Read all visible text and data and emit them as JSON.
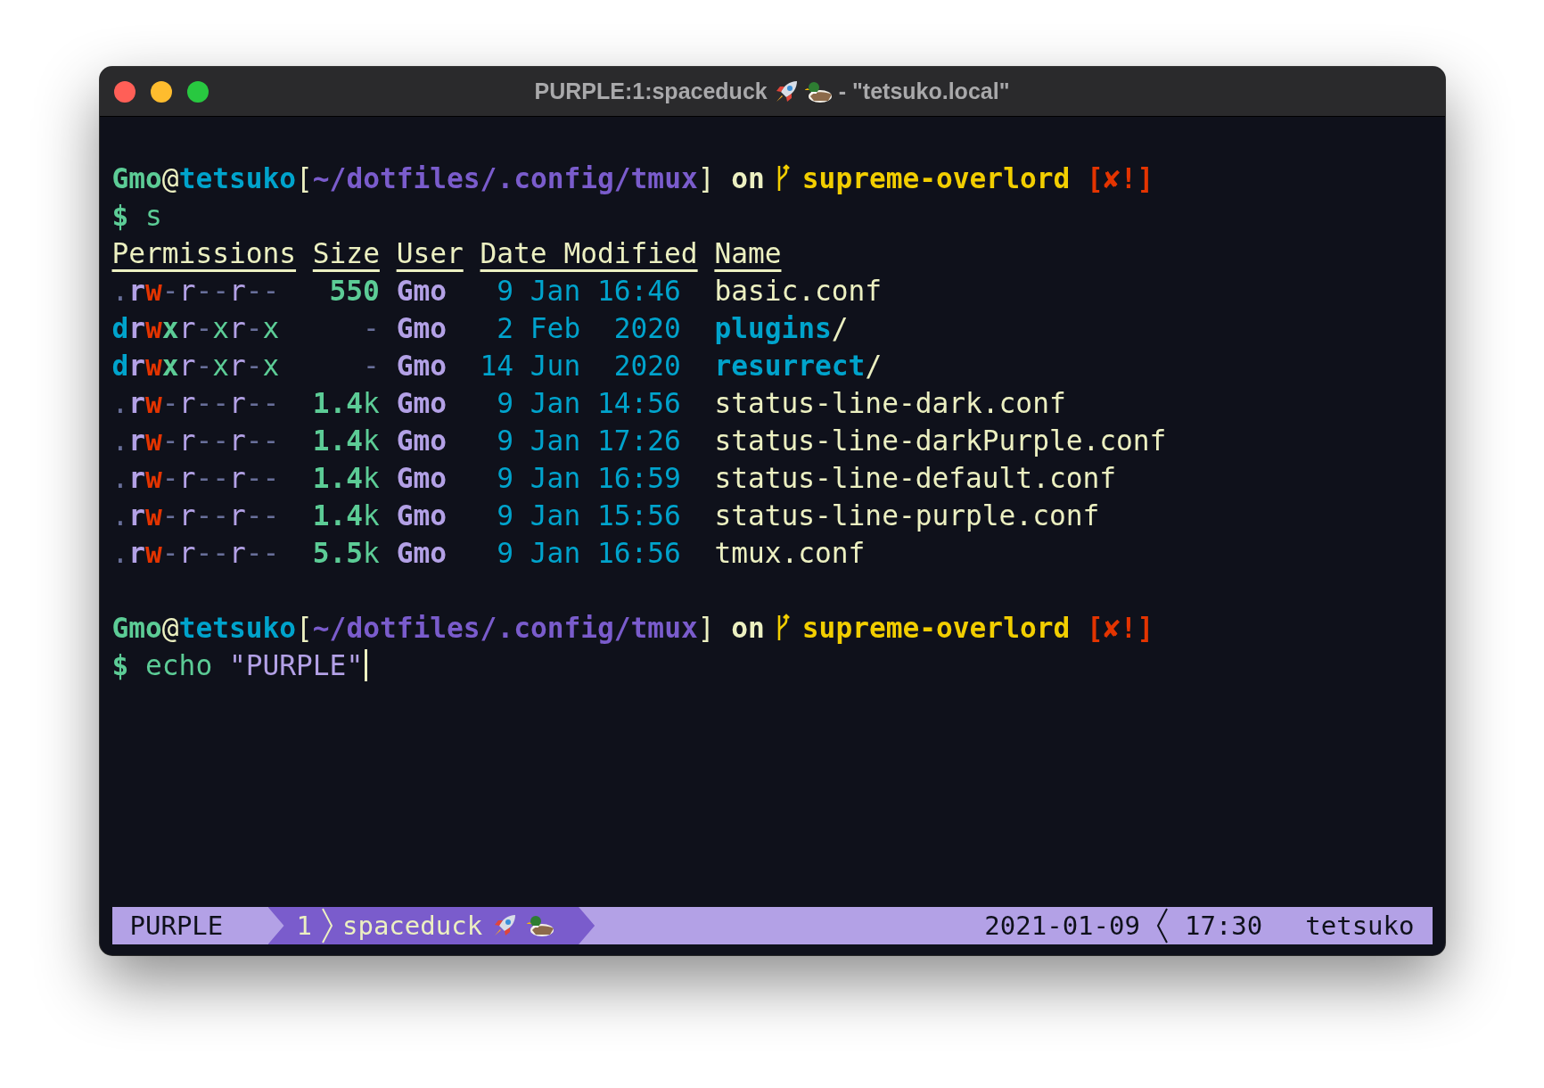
{
  "window": {
    "title": "PURPLE:1:spaceduck",
    "title_suffix": "- \"tetsuko.local\""
  },
  "terminal": {
    "blocks": [
      {
        "kind": "prompt",
        "user": "Gmo",
        "at": "@",
        "host": "tetsuko",
        "open": "[",
        "path": "~/dotfiles/.config/tmux",
        "close": "]",
        "on": "on",
        "branch": "supreme-overlord",
        "status": "[✘!]"
      },
      {
        "kind": "command",
        "symbol": "$",
        "command": "s"
      },
      {
        "kind": "listing",
        "columns": [
          "Permissions",
          "Size",
          "User",
          "Date Modified",
          "Name"
        ],
        "rows": [
          {
            "permissions": [
              {
                "text": ".",
                "kind": "type"
              },
              {
                "text": "r",
                "kind": "owner-read"
              },
              {
                "text": "w",
                "kind": "owner-write"
              },
              {
                "text": "-",
                "kind": "none"
              },
              {
                "text": "r",
                "kind": "read"
              },
              {
                "text": "--",
                "kind": "none"
              },
              {
                "text": "r",
                "kind": "read"
              },
              {
                "text": "--",
                "kind": "none"
              }
            ],
            "size": {
              "value": "550",
              "kind": "number"
            },
            "user": "Gmo",
            "date": "9 Jan 16:46",
            "name": "basic.conf",
            "kind": "file"
          },
          {
            "permissions": [
              {
                "text": "d",
                "kind": "dir"
              },
              {
                "text": "r",
                "kind": "owner-read"
              },
              {
                "text": "w",
                "kind": "owner-write"
              },
              {
                "text": "x",
                "kind": "owner-exec"
              },
              {
                "text": "r",
                "kind": "read"
              },
              {
                "text": "-",
                "kind": "none"
              },
              {
                "text": "x",
                "kind": "exec"
              },
              {
                "text": "r",
                "kind": "read"
              },
              {
                "text": "-",
                "kind": "none"
              },
              {
                "text": "x",
                "kind": "exec"
              }
            ],
            "size": {
              "value": "-",
              "kind": "empty"
            },
            "user": "Gmo",
            "date": "2 Feb  2020",
            "name": "plugins",
            "suffix": "/",
            "kind": "dir"
          },
          {
            "permissions": [
              {
                "text": "d",
                "kind": "dir"
              },
              {
                "text": "r",
                "kind": "owner-read"
              },
              {
                "text": "w",
                "kind": "owner-write"
              },
              {
                "text": "x",
                "kind": "owner-exec"
              },
              {
                "text": "r",
                "kind": "read"
              },
              {
                "text": "-",
                "kind": "none"
              },
              {
                "text": "x",
                "kind": "exec"
              },
              {
                "text": "r",
                "kind": "read"
              },
              {
                "text": "-",
                "kind": "none"
              },
              {
                "text": "x",
                "kind": "exec"
              }
            ],
            "size": {
              "value": "-",
              "kind": "empty"
            },
            "user": "Gmo",
            "date": "14 Jun  2020",
            "name": "resurrect",
            "suffix": "/",
            "kind": "dir"
          },
          {
            "permissions": [
              {
                "text": ".",
                "kind": "type"
              },
              {
                "text": "r",
                "kind": "owner-read"
              },
              {
                "text": "w",
                "kind": "owner-write"
              },
              {
                "text": "-",
                "kind": "none"
              },
              {
                "text": "r",
                "kind": "read"
              },
              {
                "text": "--",
                "kind": "none"
              },
              {
                "text": "r",
                "kind": "read"
              },
              {
                "text": "--",
                "kind": "none"
              }
            ],
            "size": {
              "value": "1.4",
              "unit": "k",
              "kind": "number"
            },
            "user": "Gmo",
            "date": "9 Jan 14:56",
            "name": "status-line-dark.conf",
            "kind": "file"
          },
          {
            "permissions": [
              {
                "text": ".",
                "kind": "type"
              },
              {
                "text": "r",
                "kind": "owner-read"
              },
              {
                "text": "w",
                "kind": "owner-write"
              },
              {
                "text": "-",
                "kind": "none"
              },
              {
                "text": "r",
                "kind": "read"
              },
              {
                "text": "--",
                "kind": "none"
              },
              {
                "text": "r",
                "kind": "read"
              },
              {
                "text": "--",
                "kind": "none"
              }
            ],
            "size": {
              "value": "1.4",
              "unit": "k",
              "kind": "number"
            },
            "user": "Gmo",
            "date": "9 Jan 17:26",
            "name": "status-line-darkPurple.conf",
            "kind": "file"
          },
          {
            "permissions": [
              {
                "text": ".",
                "kind": "type"
              },
              {
                "text": "r",
                "kind": "owner-read"
              },
              {
                "text": "w",
                "kind": "owner-write"
              },
              {
                "text": "-",
                "kind": "none"
              },
              {
                "text": "r",
                "kind": "read"
              },
              {
                "text": "--",
                "kind": "none"
              },
              {
                "text": "r",
                "kind": "read"
              },
              {
                "text": "--",
                "kind": "none"
              }
            ],
            "size": {
              "value": "1.4",
              "unit": "k",
              "kind": "number"
            },
            "user": "Gmo",
            "date": "9 Jan 16:59",
            "name": "status-line-default.conf",
            "kind": "file"
          },
          {
            "permissions": [
              {
                "text": ".",
                "kind": "type"
              },
              {
                "text": "r",
                "kind": "owner-read"
              },
              {
                "text": "w",
                "kind": "owner-write"
              },
              {
                "text": "-",
                "kind": "none"
              },
              {
                "text": "r",
                "kind": "read"
              },
              {
                "text": "--",
                "kind": "none"
              },
              {
                "text": "r",
                "kind": "read"
              },
              {
                "text": "--",
                "kind": "none"
              }
            ],
            "size": {
              "value": "1.4",
              "unit": "k",
              "kind": "number"
            },
            "user": "Gmo",
            "date": "9 Jan 15:56",
            "name": "status-line-purple.conf",
            "kind": "file"
          },
          {
            "permissions": [
              {
                "text": ".",
                "kind": "type"
              },
              {
                "text": "r",
                "kind": "owner-read"
              },
              {
                "text": "w",
                "kind": "owner-write"
              },
              {
                "text": "-",
                "kind": "none"
              },
              {
                "text": "r",
                "kind": "read"
              },
              {
                "text": "--",
                "kind": "none"
              },
              {
                "text": "r",
                "kind": "read"
              },
              {
                "text": "--",
                "kind": "none"
              }
            ],
            "size": {
              "value": "5.5",
              "unit": "k",
              "kind": "number"
            },
            "user": "Gmo",
            "date": "9 Jan 16:56",
            "name": "tmux.conf",
            "kind": "file"
          }
        ]
      },
      {
        "kind": "prompt",
        "user": "Gmo",
        "at": "@",
        "host": "tetsuko",
        "open": "[",
        "path": "~/dotfiles/.config/tmux",
        "close": "]",
        "on": "on",
        "branch": "supreme-overlord",
        "status": "[✘!]"
      },
      {
        "kind": "command",
        "symbol": "$",
        "command": "echo",
        "argument": "\"PURPLE\"",
        "cursor": true
      }
    ]
  },
  "status_bar": {
    "session": "PURPLE",
    "window_index": "1",
    "window_name": "spaceduck",
    "date": "2021-01-09",
    "time": "17:30",
    "host": "tetsuko"
  }
}
